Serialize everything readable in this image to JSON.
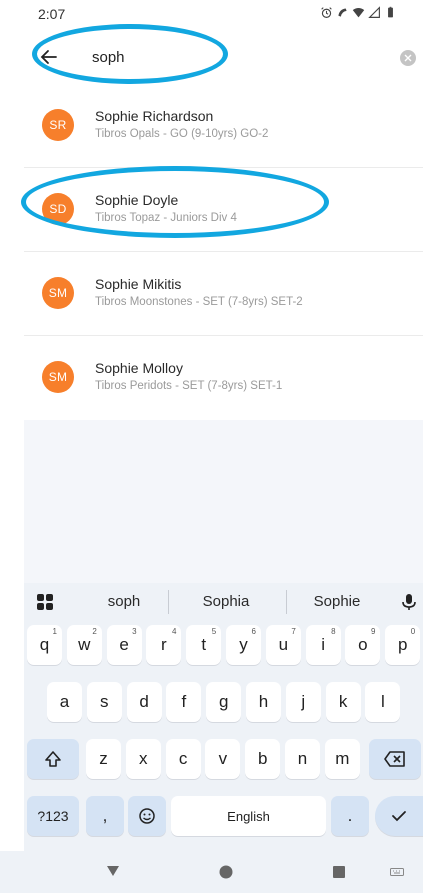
{
  "status": {
    "time": "2:07",
    "icons": [
      "alarm-icon",
      "vibrate-icon",
      "wifi-icon",
      "signal-icon",
      "battery-icon"
    ]
  },
  "search": {
    "query": "soph",
    "placeholder": ""
  },
  "results": [
    {
      "initials": "SR",
      "name": "Sophie Richardson",
      "team": "Tibros Opals - GO (9-10yrs) GO-2"
    },
    {
      "initials": "SD",
      "name": "Sophie Doyle",
      "team": "Tibros Topaz - Juniors Div 4"
    },
    {
      "initials": "SM",
      "name": "Sophie Mikitis",
      "team": "Tibros Moonstones - SET (7-8yrs) SET-2"
    },
    {
      "initials": "SM",
      "name": "Sophie Molloy",
      "team": "Tibros Peridots - SET (7-8yrs) SET-1"
    }
  ],
  "keyboard": {
    "suggestions": [
      "soph",
      "Sophia",
      "Sophie"
    ],
    "row1": [
      {
        "k": "q",
        "h": "1"
      },
      {
        "k": "w",
        "h": "2"
      },
      {
        "k": "e",
        "h": "3"
      },
      {
        "k": "r",
        "h": "4"
      },
      {
        "k": "t",
        "h": "5"
      },
      {
        "k": "y",
        "h": "6"
      },
      {
        "k": "u",
        "h": "7"
      },
      {
        "k": "i",
        "h": "8"
      },
      {
        "k": "o",
        "h": "9"
      },
      {
        "k": "p",
        "h": "0"
      }
    ],
    "row2": [
      "a",
      "s",
      "d",
      "f",
      "g",
      "h",
      "j",
      "k",
      "l"
    ],
    "row3": [
      "z",
      "x",
      "c",
      "v",
      "b",
      "n",
      "m"
    ],
    "symbols_label": "?123",
    "comma_label": ",",
    "space_label": "English",
    "period_label": "."
  },
  "colors": {
    "avatar": "#f77f2b",
    "highlight": "#12a7e0",
    "keyboard_bg": "#eef2f7",
    "mod_key": "#d5e3f4"
  }
}
